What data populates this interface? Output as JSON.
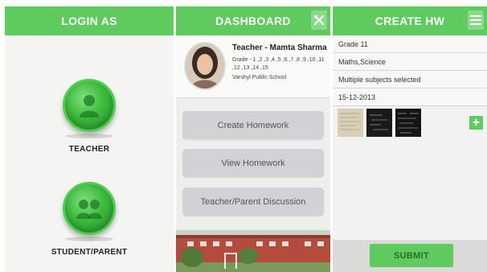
{
  "login_screen": {
    "title": "LOGIN AS",
    "roles": [
      {
        "label": "TEACHER",
        "icon": "teacher-icon"
      },
      {
        "label": "STUDENT/PARENT",
        "icon": "student-parent-icon"
      }
    ]
  },
  "dashboard_screen": {
    "title": "DASHBOARD",
    "header_icon": "tools-icon",
    "profile": {
      "name": "Teacher - Mamta Sharma",
      "grades": "Grade - 1 ,2 ,3 ,4 ,5 ,6 ,7 ,8 ,9 ,10 ,11 ,12 ,13 ,14 ,15",
      "school": "Varshyl Public School"
    },
    "buttons": [
      "Create Homework",
      "View Homework",
      "Teacher/Parent Discussion"
    ]
  },
  "create_hw_screen": {
    "title": "CREATE HW",
    "header_icon": "menu-icon",
    "fields": {
      "grade": "Grade 11",
      "subjects": "Maths,Science",
      "selection_status": "Multiple subjects selected",
      "date": "15-12-2013"
    },
    "add_label": "+",
    "submit_label": "SUBMIT"
  },
  "colors": {
    "accent": "#5fcb5f",
    "button_gray": "#d2d2d6"
  }
}
